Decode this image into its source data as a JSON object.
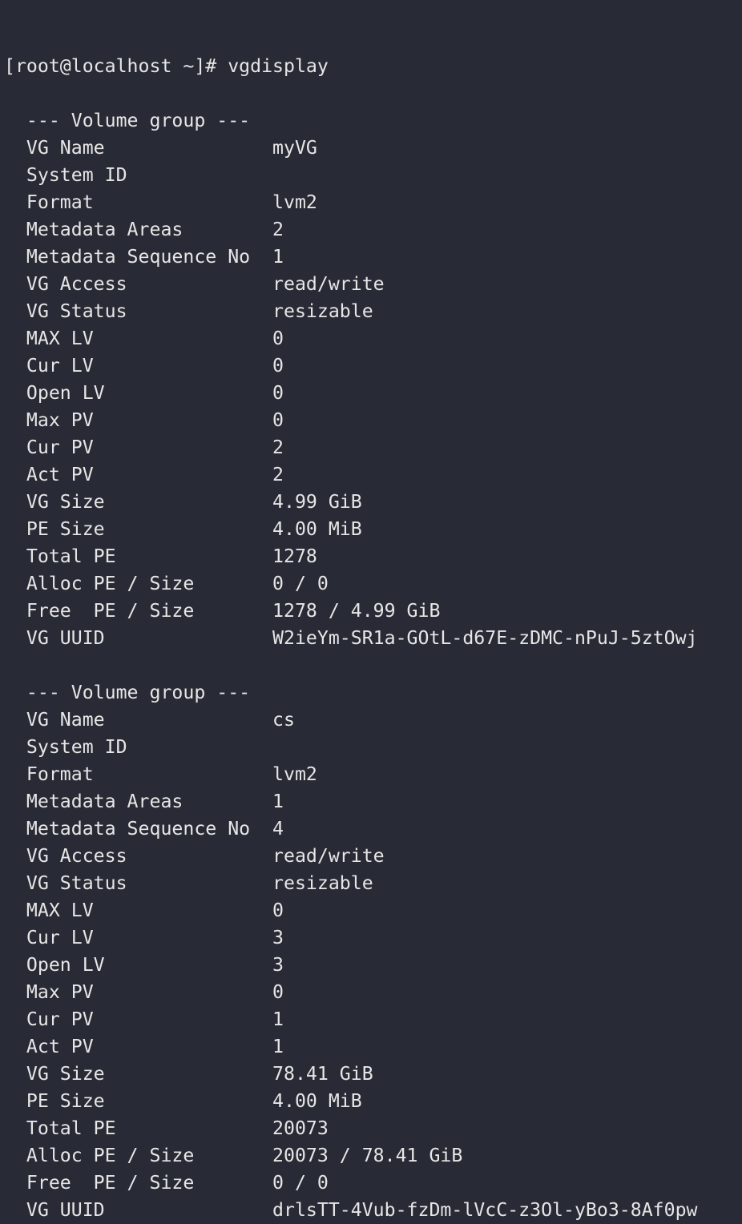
{
  "terminal": {
    "prompt": "[root@localhost ~]# ",
    "command": "vgdisplay",
    "groups": [
      {
        "header": "--- Volume group ---",
        "rows": [
          {
            "label": "VG Name",
            "value": "myVG"
          },
          {
            "label": "System ID",
            "value": ""
          },
          {
            "label": "Format",
            "value": "lvm2"
          },
          {
            "label": "Metadata Areas",
            "value": "2"
          },
          {
            "label": "Metadata Sequence No",
            "value": "1"
          },
          {
            "label": "VG Access",
            "value": "read/write"
          },
          {
            "label": "VG Status",
            "value": "resizable"
          },
          {
            "label": "MAX LV",
            "value": "0"
          },
          {
            "label": "Cur LV",
            "value": "0"
          },
          {
            "label": "Open LV",
            "value": "0"
          },
          {
            "label": "Max PV",
            "value": "0"
          },
          {
            "label": "Cur PV",
            "value": "2"
          },
          {
            "label": "Act PV",
            "value": "2"
          },
          {
            "label": "VG Size",
            "value": "4.99 GiB"
          },
          {
            "label": "PE Size",
            "value": "4.00 MiB"
          },
          {
            "label": "Total PE",
            "value": "1278"
          },
          {
            "label": "Alloc PE / Size",
            "value": "0 / 0"
          },
          {
            "label": "Free  PE / Size",
            "value": "1278 / 4.99 GiB"
          },
          {
            "label": "VG UUID",
            "value": "W2ieYm-SR1a-GOtL-d67E-zDMC-nPuJ-5ztOwj"
          }
        ]
      },
      {
        "header": "--- Volume group ---",
        "rows": [
          {
            "label": "VG Name",
            "value": "cs"
          },
          {
            "label": "System ID",
            "value": ""
          },
          {
            "label": "Format",
            "value": "lvm2"
          },
          {
            "label": "Metadata Areas",
            "value": "1"
          },
          {
            "label": "Metadata Sequence No",
            "value": "4"
          },
          {
            "label": "VG Access",
            "value": "read/write"
          },
          {
            "label": "VG Status",
            "value": "resizable"
          },
          {
            "label": "MAX LV",
            "value": "0"
          },
          {
            "label": "Cur LV",
            "value": "3"
          },
          {
            "label": "Open LV",
            "value": "3"
          },
          {
            "label": "Max PV",
            "value": "0"
          },
          {
            "label": "Cur PV",
            "value": "1"
          },
          {
            "label": "Act PV",
            "value": "1"
          },
          {
            "label": "VG Size",
            "value": "78.41 GiB"
          },
          {
            "label": "PE Size",
            "value": "4.00 MiB"
          },
          {
            "label": "Total PE",
            "value": "20073"
          },
          {
            "label": "Alloc PE / Size",
            "value": "20073 / 78.41 GiB"
          },
          {
            "label": "Free  PE / Size",
            "value": "0 / 0"
          },
          {
            "label": "VG UUID",
            "value": "drlsTT-4Vub-fzDm-lVcC-z3Ol-yBo3-8Af0pw"
          }
        ]
      }
    ]
  }
}
